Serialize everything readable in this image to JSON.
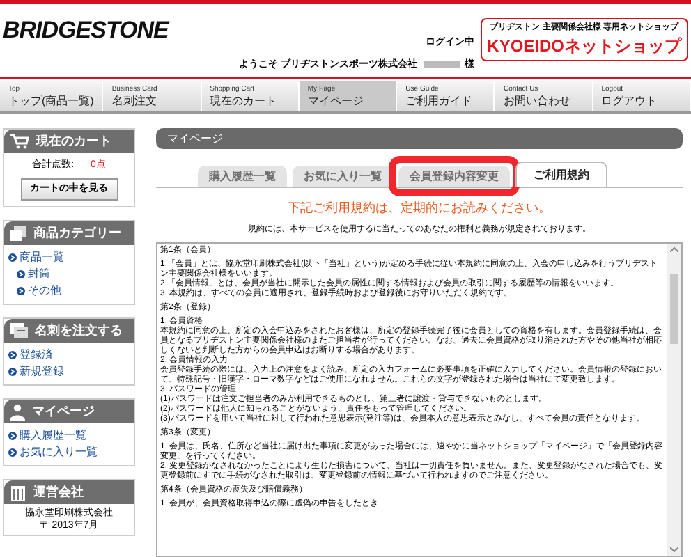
{
  "header": {
    "logo": "BRIDGESTONE",
    "login_status": "ログイン中",
    "welcome": "ようこそ ブリヂストンスポーツ株式会社",
    "honorific": "様",
    "shop_tagline": "ブリヂストン 主要関係会社様 専用ネットショップ",
    "shop_name": "KYOEIDOネットショップ"
  },
  "nav": [
    {
      "en": "Top",
      "ja": "トップ(商品一覧)",
      "selected": false
    },
    {
      "en": "Business Card",
      "ja": "名刺注文",
      "selected": false
    },
    {
      "en": "Shopping Cart",
      "ja": "現在のカート",
      "selected": false
    },
    {
      "en": "My Page",
      "ja": "マイページ",
      "selected": true
    },
    {
      "en": "Use Guide",
      "ja": "ご利用ガイド",
      "selected": false
    },
    {
      "en": "Contact Us",
      "ja": "お問い合わせ",
      "selected": false
    },
    {
      "en": "Logout",
      "ja": "ログアウト",
      "selected": false
    }
  ],
  "sidebar": {
    "cart": {
      "title": "現在のカート",
      "total_label": "合計点数:",
      "total_value": "0点",
      "button": "カートの中を見る"
    },
    "sections": [
      {
        "kind": "category",
        "title": "商品カテゴリー",
        "links": [
          {
            "label": "商品一覧",
            "children": [
              {
                "label": "封筒"
              },
              {
                "label": "その他"
              }
            ]
          }
        ]
      },
      {
        "kind": "card",
        "title": "名刺を注文する",
        "links": [
          {
            "label": "登録済"
          },
          {
            "label": "新規登録"
          }
        ]
      },
      {
        "kind": "user",
        "title": "マイページ",
        "links": [
          {
            "label": "購入履歴一覧"
          },
          {
            "label": "お気に入り一覧"
          }
        ]
      }
    ],
    "company": {
      "title": "運営会社",
      "lines": [
        "協永堂印刷株式会社",
        "〒 2013年7月"
      ]
    }
  },
  "main": {
    "title": "マイページ",
    "tabs": [
      {
        "label": "購入履歴一覧",
        "selected": false,
        "highlighted": false
      },
      {
        "label": "お気に入り一覧",
        "selected": false,
        "highlighted": false
      },
      {
        "label": "会員登録内容変更",
        "selected": false,
        "highlighted": true
      },
      {
        "label": "ご利用規約",
        "selected": true,
        "highlighted": false
      }
    ],
    "notice": "下記ご利用規約は、定期的にお読みください。",
    "subtitle": "規約には、本サービスを使用するに当たってのあなたの権利と義務が規定されております。",
    "terms": [
      {
        "kind": "heading",
        "text": "第1条（会員）"
      },
      {
        "kind": "para",
        "text": "1.「会員」とは、協永堂印刷株式会社(以下「当社」という)が定める手続に従い本規約に同意の上、入会の申し込みを行うブリヂストン主要関係会社様をいいます。"
      },
      {
        "kind": "para",
        "text": "2.「会員情報」とは、会員が当社に開示した会員の属性に関する情報および会員の取引に関する履歴等の情報をいいます。"
      },
      {
        "kind": "para",
        "text": "3. 本規約は、すべての会員に適用され、登録手続時および登録後にお守りいただく規約です。"
      },
      {
        "kind": "heading",
        "text": "第2条（登録）"
      },
      {
        "kind": "para",
        "text": "1. 会員資格"
      },
      {
        "kind": "para",
        "text": "本規約に同意の上、所定の入会申込みをされたお客様は、所定の登録手続完了後に会員としての資格を有します。会員登録手続は、会員となるブリヂストン主要関係会社様のまたご担当者が行ってください。なお、過去に会員資格が取り消された方やその他当社が相応しくないと判断した方からの会員申込はお断りする場合があります。"
      },
      {
        "kind": "para",
        "text": "2. 会員情報の入力"
      },
      {
        "kind": "para",
        "text": "会員登録手続の際には、入力上の注意をよく読み、所定の入力フォームに必要事項を正確に入力してください。会員情報の登録において、特殊記号・旧漢字・ローマ数字などはご使用になれません。これらの文字が登録された場合は当社にて変更致します。"
      },
      {
        "kind": "para",
        "text": "3. パスワードの管理"
      },
      {
        "kind": "para",
        "text": "(1)パスワードは注文ご担当者のみが利用できるものとし、第三者に譲渡・貸与できないものとします。"
      },
      {
        "kind": "para",
        "text": "(2)パスワードは他人に知られることがないよう、責任をもって管理してください。"
      },
      {
        "kind": "para",
        "text": "(3)パスワードを用いて当社に対して行われた意思表示(発注等)は、会員本人の意思表示とみなし、すべて会員の責任となります。"
      },
      {
        "kind": "heading",
        "text": "第3条（変更）"
      },
      {
        "kind": "para",
        "text": "1. 会員は、氏名、住所など当社に届け出た事項に変更があった場合には、速やかに当ネットショップ「マイページ」で「会員登録内容変更」を行ってください。"
      },
      {
        "kind": "para",
        "text": "2. 変更登録がなされなかったことにより生じた損害について、当社は一切責任を負いません。また、変更登録がなされた場合でも、変更登録前にすでに手続がなされた取引は、変更登録前の情報に基づいて行われますのでご注意ください。"
      },
      {
        "kind": "heading",
        "text": "第4条（会員資格の喪失及び賠償義務）"
      },
      {
        "kind": "para",
        "text": "1. 会員が、会員資格取得申込の際に虚偽の申告をしたとき"
      }
    ]
  }
}
